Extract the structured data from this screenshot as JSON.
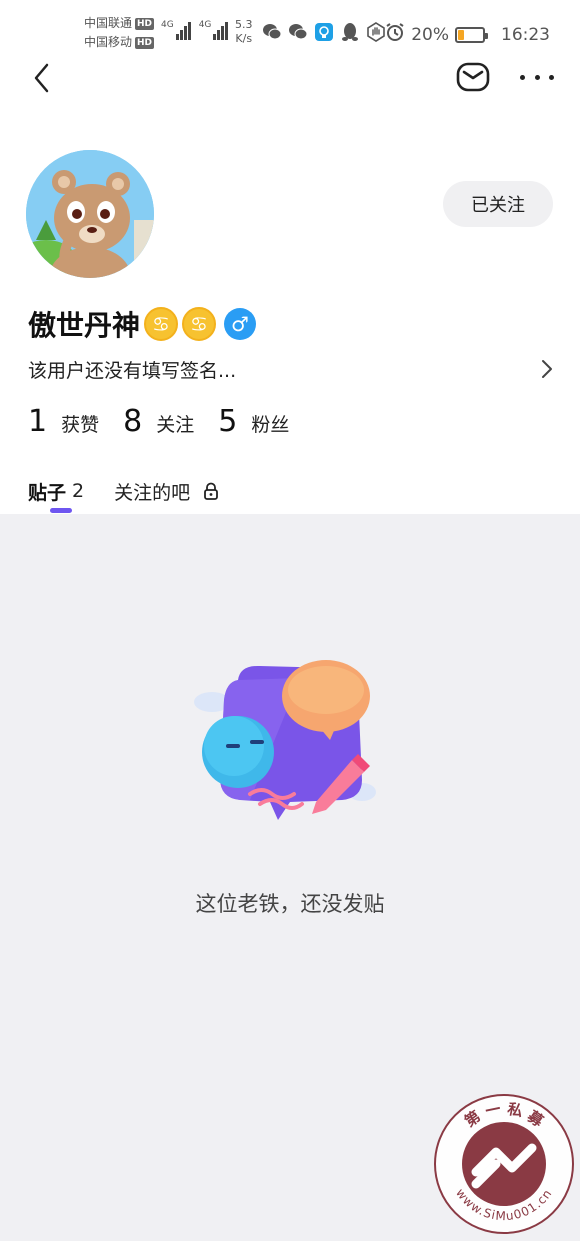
{
  "status_bar": {
    "carrier_1": "中国联通",
    "carrier_2": "中国移动",
    "hd_badge": "HD",
    "network_1": "4G",
    "network_2": "4G",
    "net_speed": "5.3",
    "net_speed_unit": "K/s",
    "battery_percent": "20%",
    "time": "16:23",
    "icons": [
      "wechat-icon",
      "wechat-icon",
      "lightbulb-app-icon",
      "qq-icon",
      "hand-stop-icon",
      "alarm-icon",
      "battery-icon"
    ]
  },
  "profile": {
    "username": "傲世丹神",
    "zodiac_symbol_1": "♋",
    "zodiac_symbol_2": "♋",
    "gender_symbol": "♂",
    "bio": "该用户还没有填写签名...",
    "follow_button": "已关注",
    "stats": [
      {
        "num": "1",
        "label": "获赞"
      },
      {
        "num": "8",
        "label": "关注"
      },
      {
        "num": "5",
        "label": "粉丝"
      }
    ]
  },
  "tabs": [
    {
      "label": "贴子",
      "count": "2",
      "active": true
    },
    {
      "label": "关注的吧",
      "locked": true
    }
  ],
  "empty_state": {
    "text": "这位老铁，还没发贴"
  },
  "watermark": {
    "top_text": "第 一 私 募",
    "ring_text": "www.SiMu001.cn"
  },
  "colors": {
    "accent": "#6e56f0",
    "background_content": "#f0f0f3",
    "follow_button_bg": "#f0f0f2",
    "gender_blue": "#2a9df4",
    "zodiac_yellow": "#f7c230",
    "watermark_red": "#8a3a44"
  }
}
